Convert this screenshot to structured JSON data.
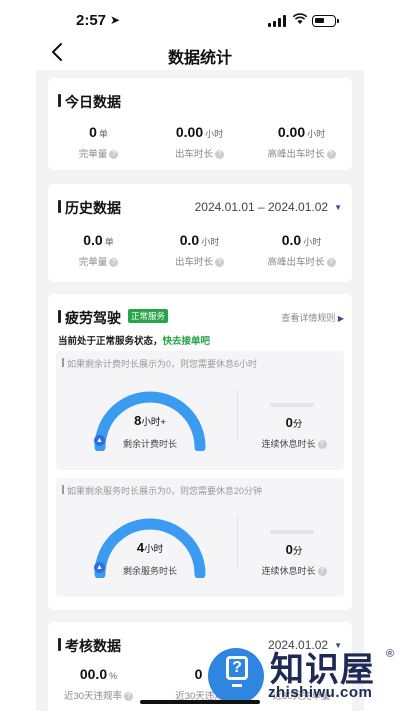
{
  "status_bar": {
    "time": "2:57",
    "wifi_icon": "wifi-icon",
    "battery_icon": "battery-icon"
  },
  "nav": {
    "title": "数据统计",
    "back_icon": "chevron-left-icon"
  },
  "today": {
    "title": "今日数据",
    "stats": [
      {
        "value": "0",
        "unit": "单",
        "label": "完单量"
      },
      {
        "value": "0.00",
        "unit": "小时",
        "label": "出车时长"
      },
      {
        "value": "0.00",
        "unit": "小时",
        "label": "高峰出车时长"
      }
    ]
  },
  "history": {
    "title": "历史数据",
    "date_range": "2024.01.01 – 2024.01.02",
    "stats": [
      {
        "value": "0.0",
        "unit": "单",
        "label": "完单量"
      },
      {
        "value": "0.0",
        "unit": "小时",
        "label": "出车时长"
      },
      {
        "value": "0.0",
        "unit": "小时",
        "label": "高峰出车时长"
      }
    ]
  },
  "fatigue": {
    "title": "疲劳驾驶",
    "badge": "正常服务",
    "rules_link": "查看详情规则",
    "state_text": "当前处于正常服务状态，",
    "state_action": "快去接单吧",
    "panels": [
      {
        "note": "如果剩余计费时长展示为0，则您需要休息6小时",
        "gauge_value": "8",
        "gauge_unit": "小时+",
        "gauge_label": "剩余计费时长",
        "gauge_fill": 1.0,
        "rest_value": "0",
        "rest_unit": "分",
        "rest_label": "连续休息时长"
      },
      {
        "note": "如果剩余服务时长展示为0，则您需要休息20分钟",
        "gauge_value": "4",
        "gauge_unit": "小时",
        "gauge_label": "剩余服务时长",
        "gauge_fill": 1.0,
        "rest_value": "0",
        "rest_unit": "分",
        "rest_label": "连续休息时长"
      }
    ]
  },
  "assessment": {
    "title": "考核数据",
    "date": "2024.01.02",
    "stats": [
      {
        "value": "00.0",
        "unit": "%",
        "label": "近30天违规率"
      },
      {
        "value": "0",
        "unit": "",
        "label": "近30天违规"
      },
      {
        "value": "",
        "unit": "",
        "label": "近30天完单量"
      }
    ]
  },
  "watermark": {
    "text": "知识屋",
    "registered": "®",
    "sub": "zhishiwu.com"
  },
  "colors": {
    "accent_blue": "#3a9bf0",
    "badge_green": "#27a445",
    "background": "#f3f3f5"
  }
}
